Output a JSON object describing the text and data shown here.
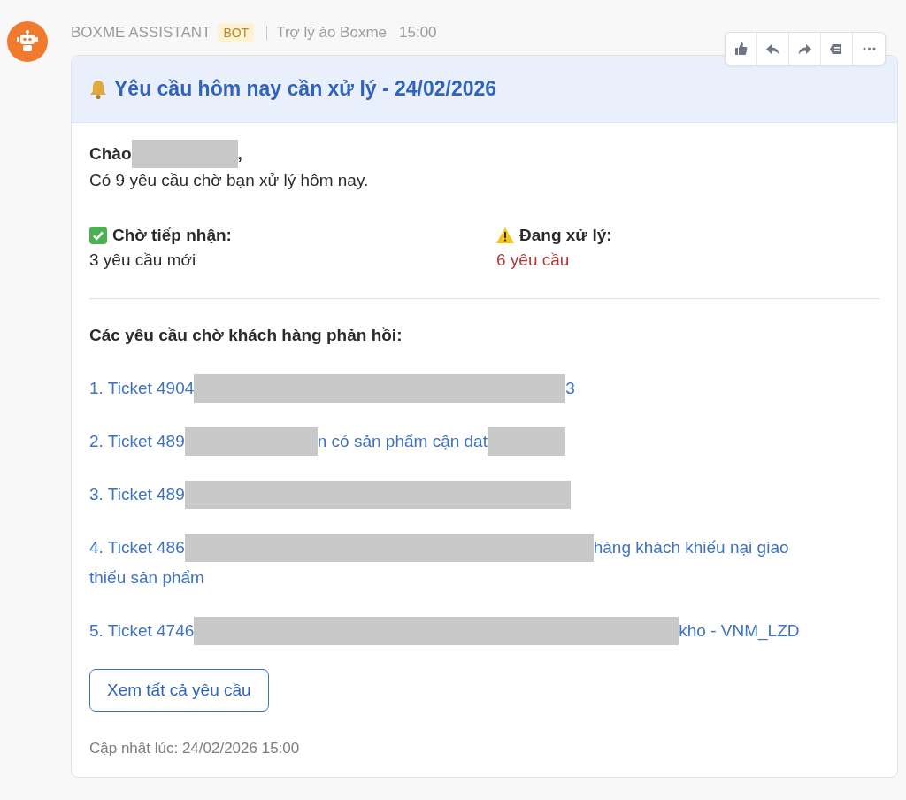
{
  "sender": {
    "name": "BOXME ASSISTANT",
    "badge": "BOT",
    "subtitle": "Trợ lý ảo Boxme",
    "time": "15:00"
  },
  "message_actions": [
    {
      "kind": "like"
    },
    {
      "kind": "reply"
    },
    {
      "kind": "forward"
    },
    {
      "kind": "save"
    },
    {
      "kind": "more"
    }
  ],
  "card": {
    "title": "Yêu cầu hôm nay cần xử lý - 24/02/2026",
    "greeting": [
      {
        "kind": "text",
        "text": "Chào"
      },
      {
        "kind": "redaction"
      },
      {
        "kind": "text",
        "text": ","
      }
    ],
    "summary": "Có 9 yêu cầu chờ bạn xử lý hôm nay.",
    "stats": [
      {
        "kind": "done",
        "label": "Chờ tiếp nhận:",
        "value": "3 yêu cầu mới"
      },
      {
        "kind": "warning",
        "label": "Đang xử lý:",
        "value": "6 yêu cầu"
      }
    ],
    "section_title": "Các yêu cầu chờ khách hàng phản hồi:",
    "tickets": [
      {
        "lines": [
          [
            {
              "kind": "text",
              "text": "1. Ticket 4904"
            },
            {
              "kind": "redaction"
            },
            {
              "kind": "text",
              "text": "3"
            }
          ]
        ]
      },
      {
        "lines": [
          [
            {
              "kind": "text",
              "text": "2. Ticket 489"
            },
            {
              "kind": "redaction"
            },
            {
              "kind": "text",
              "text": "n có sản phẩm cận dat"
            },
            {
              "kind": "redaction"
            }
          ]
        ]
      },
      {
        "lines": [
          [
            {
              "kind": "text",
              "text": "3. Ticket 489"
            },
            {
              "kind": "redaction"
            }
          ]
        ]
      },
      {
        "lines": [
          [
            {
              "kind": "text",
              "text": "4. Ticket 486"
            },
            {
              "kind": "redaction"
            },
            {
              "kind": "text",
              "text": "hàng khách khiếu nại giao"
            }
          ],
          [
            {
              "kind": "text",
              "text": "thiếu sản phẩm"
            }
          ]
        ]
      },
      {
        "lines": [
          [
            {
              "kind": "text",
              "text": "5. Ticket 4746"
            },
            {
              "kind": "redaction"
            },
            {
              "kind": "text",
              "text": "kho - VNM_LZD"
            }
          ]
        ]
      }
    ],
    "button": "Xem tất cả yêu cầu",
    "updated": "Cập nhật lúc: 24/02/2026 15:00"
  }
}
